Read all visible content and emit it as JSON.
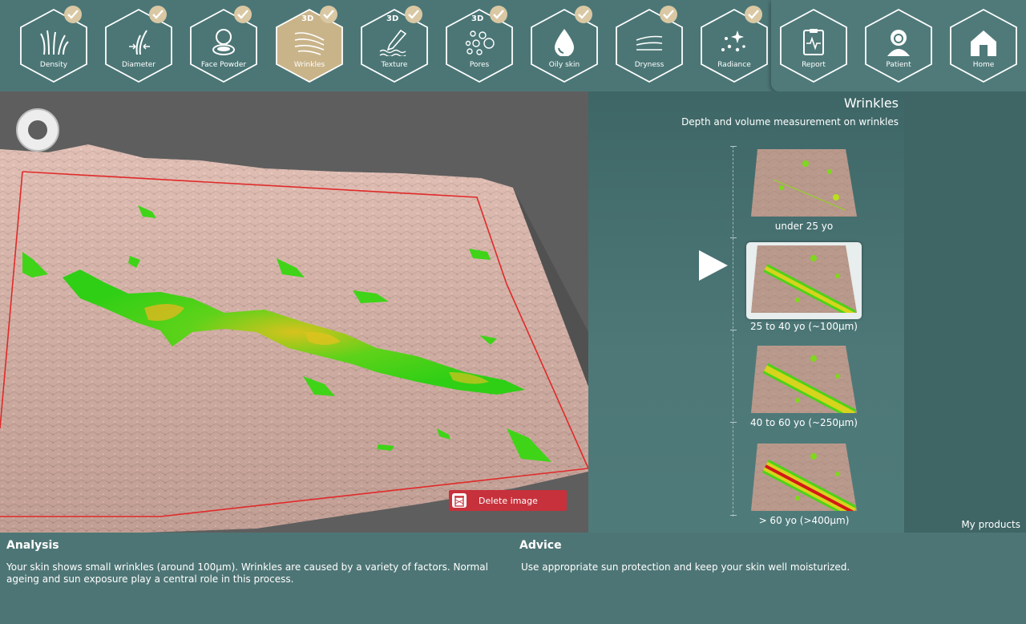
{
  "nav": {
    "items": [
      {
        "label": "Density",
        "icon": "grass-icon",
        "checked": true,
        "tag": ""
      },
      {
        "label": "Diameter",
        "icon": "hair-diameter-icon",
        "checked": true,
        "tag": ""
      },
      {
        "label": "Face Powder",
        "icon": "powder-compact-icon",
        "checked": true,
        "tag": ""
      },
      {
        "label": "Wrinkles",
        "icon": "wrinkles-icon",
        "checked": true,
        "tag": "3D",
        "active": true
      },
      {
        "label": "Texture",
        "icon": "texture-icon",
        "checked": true,
        "tag": "3D"
      },
      {
        "label": "Pores",
        "icon": "pores-icon",
        "checked": true,
        "tag": "3D"
      },
      {
        "label": "Oily skin",
        "icon": "droplet-icon",
        "checked": true,
        "tag": ""
      },
      {
        "label": "Dryness",
        "icon": "dryness-icon",
        "checked": true,
        "tag": ""
      },
      {
        "label": "Radiance",
        "icon": "sparkle-icon",
        "checked": true,
        "tag": ""
      }
    ],
    "right": [
      {
        "label": "Report",
        "icon": "report-icon"
      },
      {
        "label": "Patient",
        "icon": "patient-icon"
      },
      {
        "label": "Home",
        "icon": "home-icon"
      }
    ],
    "active_color": "#c9b48a",
    "badge_color": "#d9c8a3"
  },
  "viewer": {
    "delete_label": "Delete image",
    "delete_color": "#c7313b"
  },
  "panel": {
    "title": "Wrinkles",
    "subtitle": "Depth and volume measurement on wrinkles",
    "thumbs": [
      {
        "label": "under 25 yo",
        "severity": 0
      },
      {
        "label": "25 to 40 yo (~100µm)",
        "severity": 1,
        "selected": true
      },
      {
        "label": "40 to 60 yo (~250µm)",
        "severity": 2
      },
      {
        "label": "> 60 yo (>400µm)",
        "severity": 3
      }
    ],
    "my_products": "My products"
  },
  "analysis": {
    "title": "Analysis",
    "text": "Your skin shows small wrinkles (around 100µm). Wrinkles are caused by a variety of factors. Normal ageing and sun exposure play a central role in this process."
  },
  "advice": {
    "title": "Advice",
    "text": "Use appropriate sun protection and keep your skin well moisturized."
  }
}
